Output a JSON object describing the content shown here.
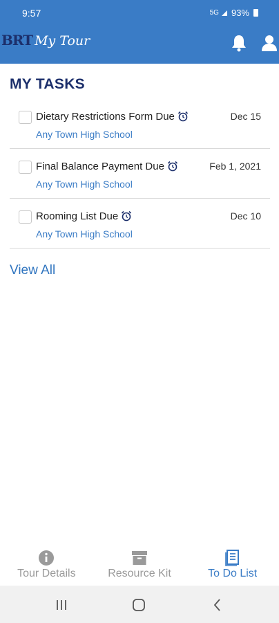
{
  "status": {
    "time": "9:57",
    "network": "5G",
    "battery": "93%"
  },
  "header": {
    "logo_brand": "BRT",
    "logo_product": "My Tour",
    "icons": [
      "bell-icon",
      "user-icon"
    ]
  },
  "page": {
    "title": "MY TASKS"
  },
  "tasks": [
    {
      "title": "Dietary Restrictions Form Due",
      "date": "Dec 15",
      "school": "Any Town High School",
      "checked": false
    },
    {
      "title": "Final Balance Payment Due",
      "date": "Feb 1, 2021",
      "school": "Any Town High School",
      "checked": false
    },
    {
      "title": "Rooming List Due",
      "date": "Dec 10",
      "school": "Any Town High School",
      "checked": false
    }
  ],
  "view_all_label": "View All",
  "bottom_nav": {
    "active": "To Do List",
    "items": [
      {
        "label": "Tour Details",
        "icon": "info-icon"
      },
      {
        "label": "Resource Kit",
        "icon": "archive-box-icon"
      },
      {
        "label": "To Do List",
        "icon": "document-list-icon"
      }
    ]
  },
  "colors": {
    "brand_blue": "#3a7cc6",
    "navy": "#1c2f6b",
    "inactive_gray": "#9a9a9a"
  }
}
